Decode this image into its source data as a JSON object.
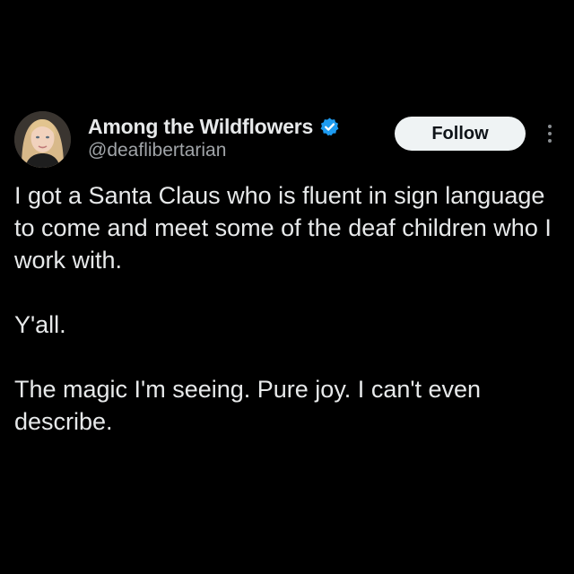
{
  "tweet": {
    "author": {
      "display_name": "Among the Wildflowers",
      "handle": "@deaflibertarian",
      "verified": true,
      "avatar": "avatar-photo"
    },
    "follow_label": "Follow",
    "more_icon": "more-vertical-icon",
    "text": "I got a Santa Claus who is fluent in sign language to come and meet some of the deaf children who I work with.\n\nY'all.\n\nThe magic I'm seeing. Pure joy. I can't even describe."
  },
  "colors": {
    "background": "#000000",
    "text": "#e7e9ea",
    "handle": "#a0a4a8",
    "verified_badge": "#1d9bf0",
    "follow_button_bg": "#eff3f4",
    "follow_button_text": "#0f1419"
  }
}
